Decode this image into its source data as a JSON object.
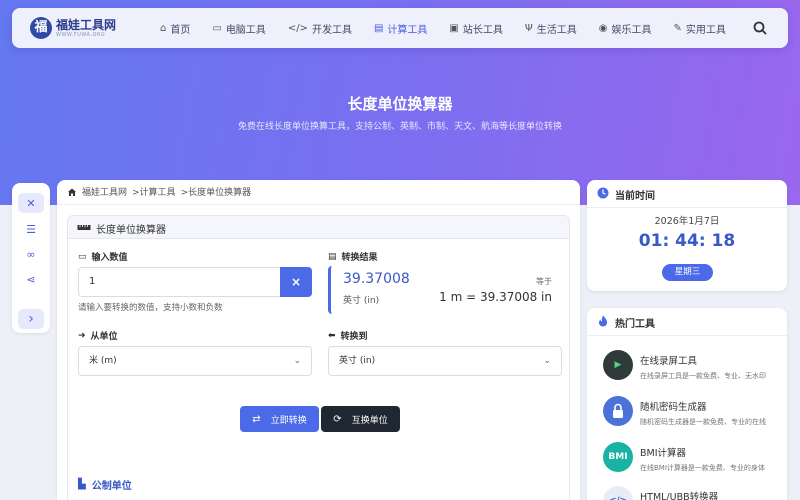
{
  "brand": {
    "logo_char": "福",
    "name": "福娃工具网",
    "domain": "WWW.FUWA.ORG"
  },
  "nav": {
    "items": [
      {
        "label": "首页",
        "icon": "home-icon",
        "glyph": "⌂"
      },
      {
        "label": "电脑工具",
        "icon": "desktop-icon",
        "glyph": "▭"
      },
      {
        "label": "开发工具",
        "icon": "code-icon",
        "glyph": "</>"
      },
      {
        "label": "计算工具",
        "icon": "calculator-icon",
        "glyph": "▤"
      },
      {
        "label": "站长工具",
        "icon": "briefcase-icon",
        "glyph": "▣"
      },
      {
        "label": "生活工具",
        "icon": "utensils-icon",
        "glyph": "Ψ"
      },
      {
        "label": "娱乐工具",
        "icon": "gamepad-icon",
        "glyph": "◉"
      },
      {
        "label": "实用工具",
        "icon": "wrench-icon",
        "glyph": "✎"
      }
    ],
    "active_index": 3
  },
  "hero": {
    "title": "长度单位换算器",
    "subtitle": "免费在线长度单位换算工具，支持公制、英制、市制、天文、航海等长度单位转换"
  },
  "side_tools": [
    {
      "icon": "tools-icon",
      "glyph": "✕"
    },
    {
      "icon": "list-icon",
      "glyph": "☰"
    },
    {
      "icon": "link-icon",
      "glyph": "∞"
    },
    {
      "icon": "share-icon",
      "glyph": "⋖"
    },
    {
      "icon": "chevron-right-icon",
      "glyph": "›"
    }
  ],
  "breadcrumb": {
    "home": "福娃工具网",
    "category": ">计算工具",
    "current": ">长度单位换算器"
  },
  "converter": {
    "title": "长度单位换算器",
    "input_label": "输入数值",
    "input_value": "1",
    "clear_glyph": "×",
    "hint": "请输入要转换的数值，支持小数和负数",
    "result_label": "转换结果",
    "result_value": "39.37008",
    "result_unit": "英寸 (in)",
    "equal_label": "等于",
    "equation": "1 m = 39.37008 in",
    "from_label": "从单位",
    "from_value": "米 (m)",
    "to_label": "转换到",
    "to_value": "英寸 (in)",
    "convert_button": "立即转换",
    "swap_button": "互换单位",
    "section_title": "公制单位"
  },
  "time_card": {
    "title": "当前时间",
    "date": "2026年1月7日",
    "time": "01: 44: 18",
    "weekday": "星期三"
  },
  "hot_tools": {
    "title": "热门工具",
    "items": [
      {
        "name": "在线录屏工具",
        "desc": "在线录屏工具是一款免费、专业、无水印",
        "icon": "screen-record-icon",
        "glyph": "▶",
        "color": "#2f3b3a"
      },
      {
        "name": "随机密码生成器",
        "desc": "随机密码生成器是一款免费、专业的在线",
        "icon": "lock-icon",
        "glyph": "🔒",
        "color": "#4a72d9"
      },
      {
        "name": "BMI计算器",
        "desc": "在线BMI计算器是一款免费、专业的身体",
        "icon": "bmi-icon",
        "glyph": "BMI",
        "color": "#19b3a6"
      },
      {
        "name": "HTML/UBB转换器",
        "desc": "",
        "icon": "code-icon",
        "glyph": "</>",
        "color": "#e8ecf5"
      }
    ]
  },
  "colors": {
    "accent": "#4a6ae8",
    "dark_button": "#1f2733",
    "hero_start": "#6478f0",
    "hero_end": "#9a67ee"
  }
}
